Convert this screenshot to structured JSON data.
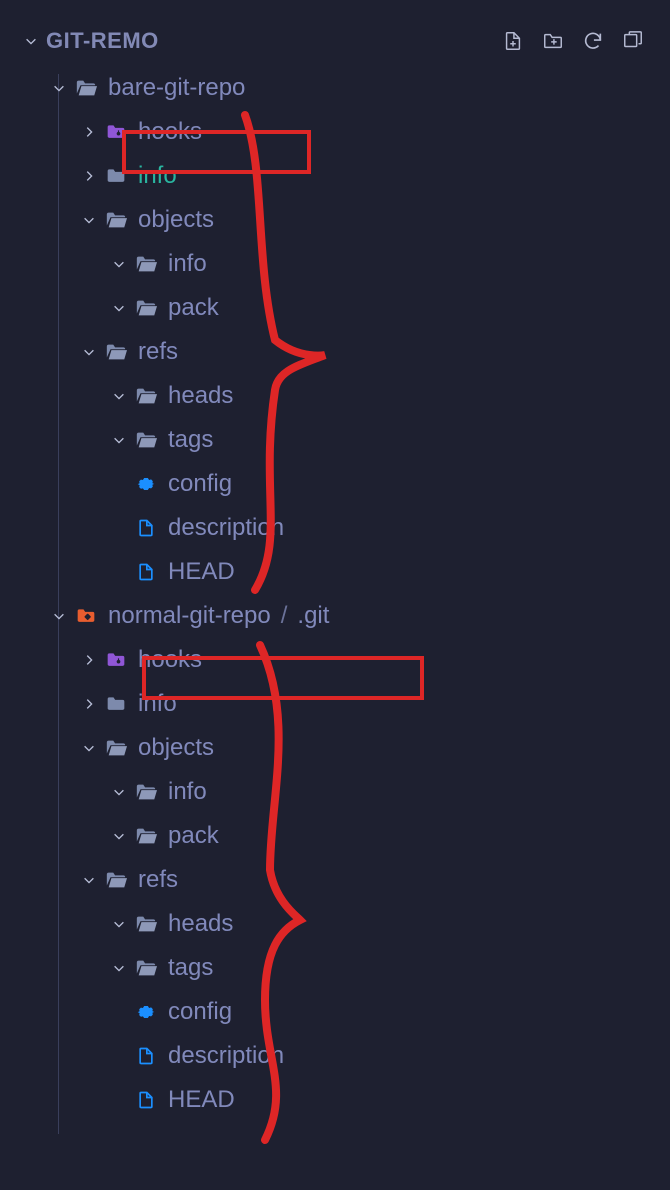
{
  "header": {
    "title": "GIT-REMO"
  },
  "tree": {
    "bare": {
      "name": "bare-git-repo",
      "hooks": "hooks",
      "info": "info",
      "objects": "objects",
      "objects_info": "info",
      "objects_pack": "pack",
      "refs": "refs",
      "refs_heads": "heads",
      "refs_tags": "tags",
      "config": "config",
      "description": "description",
      "head": "HEAD"
    },
    "normal": {
      "name": "normal-git-repo",
      "sep": "/",
      "git": ".git",
      "hooks": "hooks",
      "info": "info",
      "objects": "objects",
      "objects_info": "info",
      "objects_pack": "pack",
      "refs": "refs",
      "refs_heads": "heads",
      "refs_tags": "tags",
      "config": "config",
      "description": "description",
      "head": "HEAD"
    }
  }
}
